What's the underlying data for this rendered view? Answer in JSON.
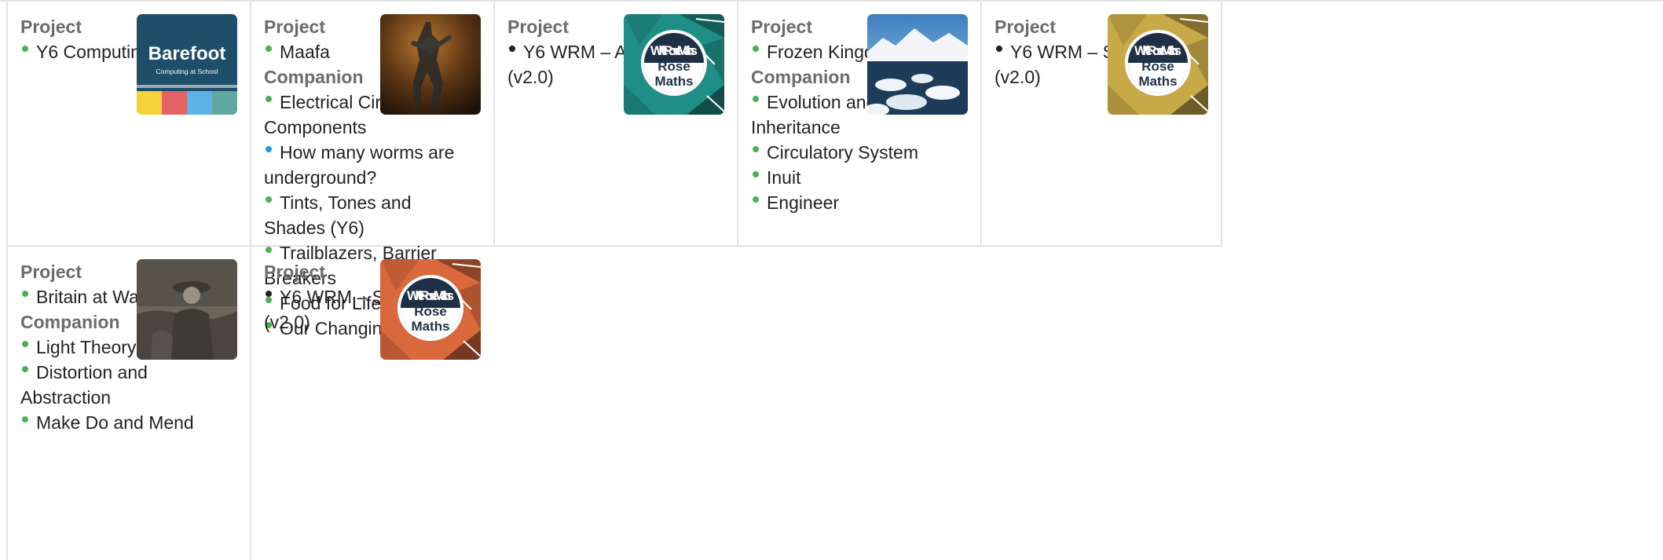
{
  "cards": [
    {
      "sections": [
        {
          "heading": "Project",
          "items": [
            {
              "label": "Y6 Computing",
              "dot": "green"
            }
          ]
        }
      ],
      "thumbnail": {
        "icon": "barefoot-logo",
        "text": "Barefoot",
        "subtext": "Computing at School"
      }
    },
    {
      "sections": [
        {
          "heading": "Project",
          "items": [
            {
              "label": "Maafa",
              "dot": "green"
            }
          ]
        },
        {
          "heading": "Companion",
          "items": [
            {
              "label": "Electrical Circuits and Components",
              "dot": "green"
            },
            {
              "label": "How many worms are underground?",
              "dot": "blue"
            },
            {
              "label": "Tints, Tones and Shades (Y6)",
              "dot": "green"
            },
            {
              "label": "Trailblazers, Barrier Breakers",
              "dot": "green"
            },
            {
              "label": "Food for Life",
              "dot": "green"
            },
            {
              "label": "Our Changing World",
              "dot": "green"
            }
          ]
        }
      ],
      "thumbnail": {
        "icon": "statue-photo"
      }
    },
    {
      "sections": [
        {
          "heading": "Project",
          "items": [
            {
              "label": "Y6 WRM – Autumn (v2.0)",
              "dot": "black"
            }
          ]
        }
      ],
      "thumbnail": {
        "icon": "white-rose-maths-logo",
        "text": "White Rose Maths",
        "color": "#1f8f86"
      }
    },
    {
      "sections": [
        {
          "heading": "Project",
          "items": [
            {
              "label": "Frozen Kingdoms",
              "dot": "green"
            }
          ]
        },
        {
          "heading": "Companion",
          "items": [
            {
              "label": "Evolution and Inheritance",
              "dot": "green"
            },
            {
              "label": "Circulatory System",
              "dot": "green"
            },
            {
              "label": "Inuit",
              "dot": "green"
            },
            {
              "label": "Engineer",
              "dot": "green"
            }
          ]
        }
      ],
      "thumbnail": {
        "icon": "arctic-landscape-photo"
      }
    },
    {
      "sections": [
        {
          "heading": "Project",
          "items": [
            {
              "label": "Y6 WRM – Spring (v2.0)",
              "dot": "black"
            }
          ]
        }
      ],
      "thumbnail": {
        "icon": "white-rose-maths-logo",
        "text": "White Rose Maths",
        "color": "#c8a948"
      }
    },
    {
      "sections": [
        {
          "heading": "Project",
          "items": [
            {
              "label": "Britain at War",
              "dot": "green"
            }
          ]
        },
        {
          "heading": "Companion",
          "items": [
            {
              "label": "Light Theory",
              "dot": "green"
            },
            {
              "label": "Distortion and Abstraction",
              "dot": "green"
            },
            {
              "label": "Make Do and Mend",
              "dot": "green"
            }
          ]
        }
      ],
      "thumbnail": {
        "icon": "soldier-photo"
      }
    },
    {
      "sections": [
        {
          "heading": "Project",
          "items": [
            {
              "label": "Y6 WRM – Summer (v2.0)",
              "dot": "black"
            }
          ]
        }
      ],
      "thumbnail": {
        "icon": "white-rose-maths-logo",
        "text": "White Rose Maths",
        "color": "#d9683d"
      }
    }
  ],
  "colors": {
    "heading": "#6b6b6b",
    "text": "#222222",
    "border": "#e3e3e3",
    "bullet_green": "#4caf50",
    "bullet_blue": "#1a9bd6",
    "bullet_black": "#222222"
  }
}
